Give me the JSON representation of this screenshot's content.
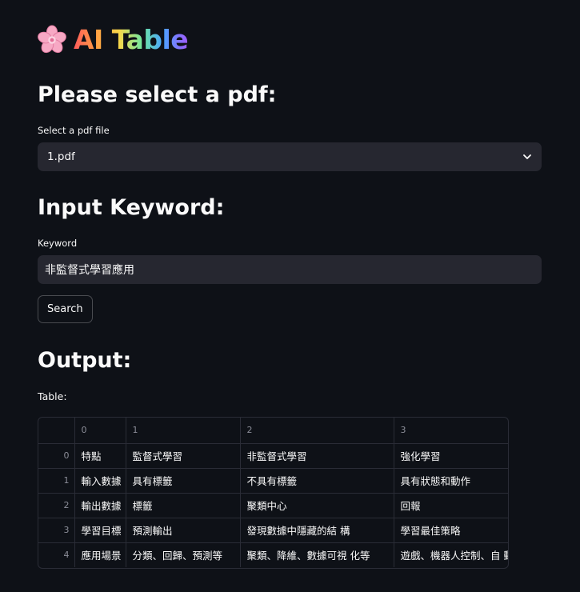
{
  "app": {
    "title": "AI Table",
    "logo_icon": "cherry-blossom-icon"
  },
  "pdf_section": {
    "heading": "Please select a pdf:",
    "select_label": "Select a pdf file",
    "selected_value": "1.pdf"
  },
  "keyword_section": {
    "heading": "Input Keyword:",
    "input_label": "Keyword",
    "input_value": "非監督式學習應用",
    "search_button": "Search"
  },
  "output_section": {
    "heading": "Output:",
    "table_label": "Table:"
  },
  "table": {
    "columns": [
      "0",
      "1",
      "2",
      "3"
    ],
    "rows": [
      {
        "index": "0",
        "cells": [
          "特點",
          "監督式學習",
          "非監督式學習",
          "強化學習"
        ]
      },
      {
        "index": "1",
        "cells": [
          "輸入數據",
          "具有標籤",
          "不具有標籤",
          "具有狀態和動作"
        ]
      },
      {
        "index": "2",
        "cells": [
          "輸出數據",
          "標籤",
          "聚類中心",
          "回報"
        ]
      },
      {
        "index": "3",
        "cells": [
          "學習目標",
          "預測輸出",
          "發現數據中隱藏的結 構",
          "學習最佳策略"
        ]
      },
      {
        "index": "4",
        "cells": [
          "應用場景",
          "分類、回歸、預測等",
          "聚類、降維、數據可視 化等",
          "遊戲、機器人控制、自 動駕駛等"
        ]
      }
    ]
  },
  "colors": {
    "background": "#0e1117",
    "input_bg": "#262730",
    "text": "#fafafa",
    "muted": "#8b8d98"
  }
}
